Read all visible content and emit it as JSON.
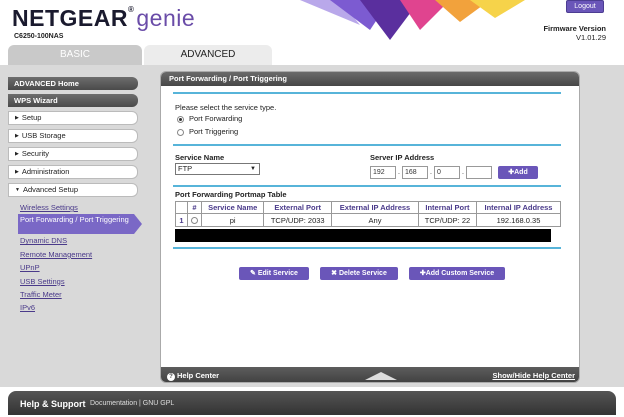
{
  "header": {
    "logo_brand": "NETGEAR",
    "logo_suffix": "genie",
    "logo_reg": "®",
    "model": "C6250-100NAS",
    "logout_label": "Logout",
    "firmware_label": "Firmware Version",
    "firmware_value": "V1.01.29"
  },
  "tabs": {
    "basic": "BASIC",
    "advanced": "ADVANCED"
  },
  "sidebar": {
    "advanced_home": "ADVANCED Home",
    "wps_wizard": "WPS Wizard",
    "sections": [
      {
        "label": "Setup",
        "arrow": "▶"
      },
      {
        "label": "USB Storage",
        "arrow": "▶"
      },
      {
        "label": "Security",
        "arrow": "▶"
      },
      {
        "label": "Administration",
        "arrow": "▶"
      },
      {
        "label": "Advanced Setup",
        "arrow": "▼"
      }
    ],
    "sub_items": [
      {
        "label": "Wireless Settings"
      },
      {
        "label": "Port Forwarding / Port Triggering"
      },
      {
        "label": "Dynamic DNS"
      },
      {
        "label": "Remote Management"
      },
      {
        "label": "UPnP"
      },
      {
        "label": "USB Settings"
      },
      {
        "label": "Traffic Meter"
      },
      {
        "label": "IPv6"
      }
    ]
  },
  "panel": {
    "title": "Port Forwarding / Port Triggering",
    "instruction": "Please select the service type.",
    "radio_forwarding": "Port Forwarding",
    "radio_triggering": "Port Triggering",
    "service_name_label": "Service Name",
    "service_name_value": "FTP",
    "server_ip_label": "Server IP Address",
    "ip": [
      "192",
      "168",
      "0",
      ""
    ],
    "ip_sep": ".",
    "add_label": "✚Add",
    "table_title": "Port Forwarding Portmap Table",
    "table_headers": [
      "#",
      "Service Name",
      "External Port",
      "External IP Address",
      "Internal Port",
      "Internal IP Address"
    ],
    "table_rows": [
      {
        "num": "1",
        "service": "pi",
        "ext_port": "TCP/UDP: 2033",
        "ext_ip": "Any",
        "int_port": "TCP/UDP: 22",
        "int_ip": "192.168.0.35"
      }
    ],
    "edit_label": "✎ Edit Service",
    "delete_label": "✖ Delete Service",
    "add_custom_label": "✚Add Custom Service",
    "help_center": "Help Center",
    "help_q": "?",
    "show_hide": "Show/Hide Help Center"
  },
  "footer": {
    "title": "Help & Support",
    "links": "Documentation | GNU GPL"
  },
  "colors": {
    "accent_purple": "#6a56b9",
    "rule_blue": "#57b4d9",
    "dark_bar": "#474747"
  }
}
